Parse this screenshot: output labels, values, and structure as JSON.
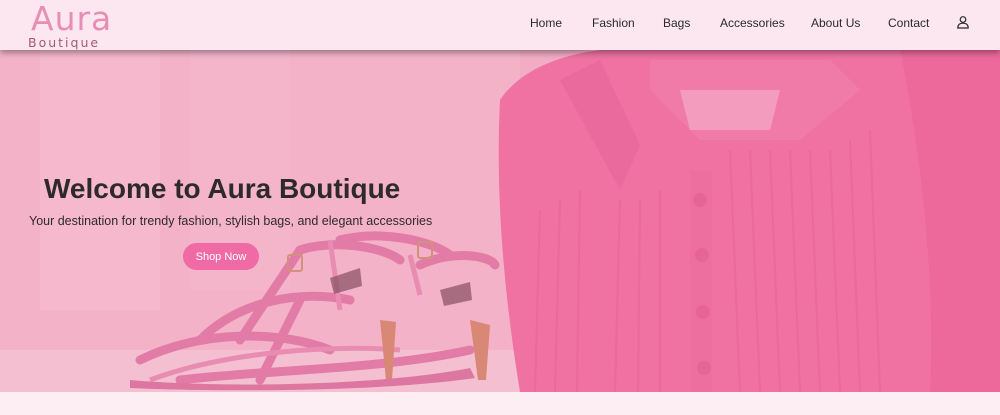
{
  "brand": {
    "name": "Aura",
    "tagline": "Boutique"
  },
  "nav": {
    "items": [
      {
        "label": "Home"
      },
      {
        "label": "Fashion"
      },
      {
        "label": "Bags"
      },
      {
        "label": "Accessories"
      },
      {
        "label": "About Us"
      },
      {
        "label": "Contact"
      }
    ],
    "account_icon": "user-icon"
  },
  "hero": {
    "title": "Welcome to Aura Boutique",
    "subtitle": "Your destination for trendy fashion, stylish bags, and elegant accessories",
    "cta_label": "Shop Now",
    "image_icon": "pink-sandals-and-sweater-photo"
  },
  "colors": {
    "brand_pink": "#e78fb3",
    "cta_pink": "#f06aa6",
    "navbar_bg": "#fce6ef"
  }
}
